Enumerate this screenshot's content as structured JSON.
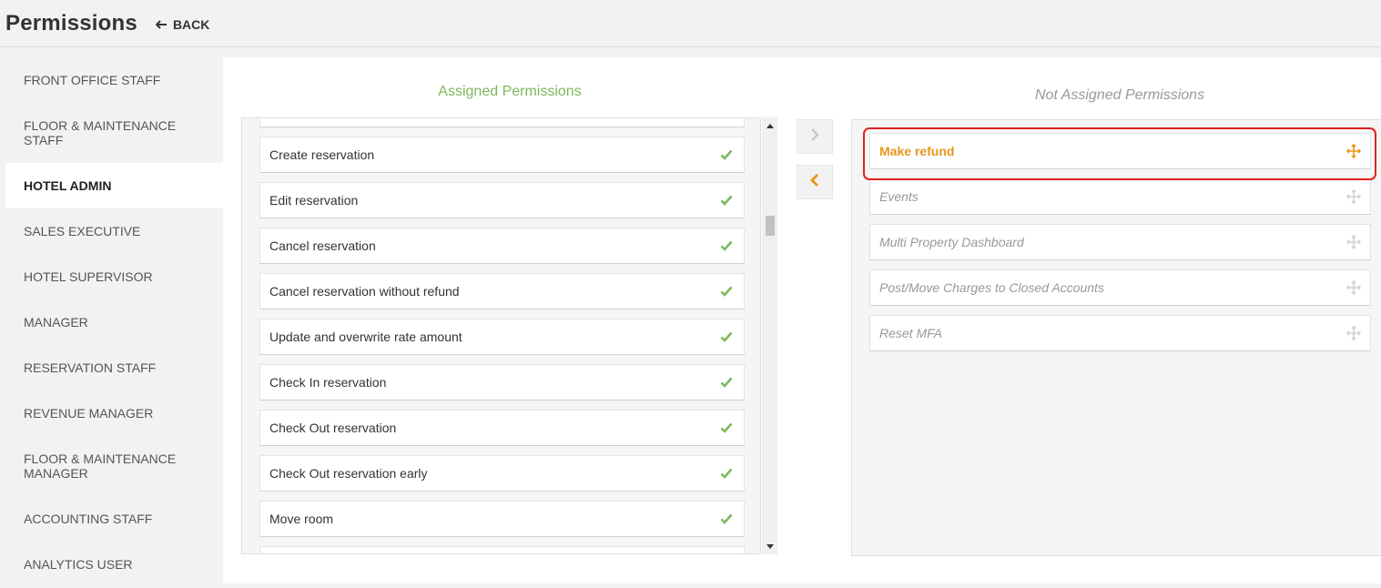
{
  "header": {
    "title": "Permissions",
    "back_label": "BACK"
  },
  "sidebar": {
    "items": [
      {
        "label": "FRONT OFFICE STAFF",
        "active": false
      },
      {
        "label": "FLOOR & MAINTENANCE STAFF",
        "active": false
      },
      {
        "label": "HOTEL ADMIN",
        "active": true
      },
      {
        "label": "SALES EXECUTIVE",
        "active": false
      },
      {
        "label": "HOTEL SUPERVISOR",
        "active": false
      },
      {
        "label": "MANAGER",
        "active": false
      },
      {
        "label": "RESERVATION STAFF",
        "active": false
      },
      {
        "label": "REVENUE MANAGER",
        "active": false
      },
      {
        "label": "FLOOR & MAINTENANCE MANAGER",
        "active": false
      },
      {
        "label": "ACCOUNTING STAFF",
        "active": false
      },
      {
        "label": "ANALYTICS USER",
        "active": false
      }
    ]
  },
  "assigned": {
    "heading": "Assigned Permissions",
    "items": [
      "Create reservation",
      "Edit reservation",
      "Cancel reservation",
      "Cancel reservation without refund",
      "Update and overwrite rate amount",
      "Check In reservation",
      "Check Out reservation",
      "Check Out reservation early",
      "Move room"
    ],
    "check_icon": "check-icon"
  },
  "not_assigned": {
    "heading": "Not Assigned Permissions",
    "items": [
      "Make refund",
      "Events",
      "Multi Property Dashboard",
      "Post/Move Charges to Closed Accounts",
      "Reset MFA"
    ],
    "highlighted_index": 0,
    "move_icon": "drag-move-icon"
  },
  "controls": {
    "move_right_icon": "chevron-right-icon",
    "move_left_icon": "chevron-left-icon",
    "scroll_position": 0.25
  },
  "colors": {
    "assigned_heading": "#7cb85b",
    "check": "#7cb85b",
    "highlight": "#e8961e",
    "outline": "#e02020"
  }
}
